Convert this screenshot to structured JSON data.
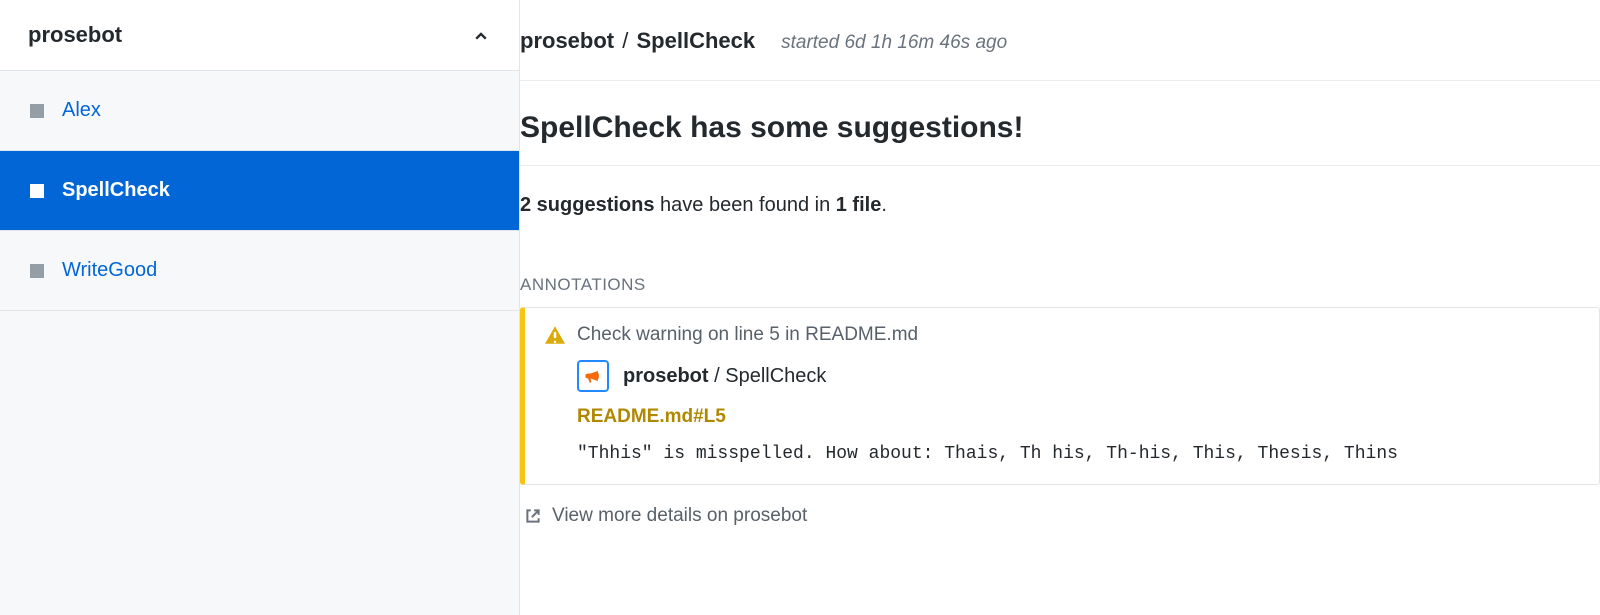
{
  "sidebar": {
    "title": "prosebot",
    "items": [
      {
        "label": "Alex",
        "active": false
      },
      {
        "label": "SpellCheck",
        "active": true
      },
      {
        "label": "WriteGood",
        "active": false
      }
    ]
  },
  "header": {
    "breadcrumb_app": "prosebot",
    "breadcrumb_sep": "/",
    "breadcrumb_check": "SpellCheck",
    "started": "started 6d 1h 16m 46s ago"
  },
  "report": {
    "title": "SpellCheck has some suggestions!",
    "summary_count": "2 suggestions",
    "summary_middle": " have been found in ",
    "summary_files": "1 file",
    "summary_tail": "."
  },
  "annotations": {
    "heading": "ANNOTATIONS",
    "item": {
      "header": "Check warning on line 5 in README.md",
      "app_name": "prosebot",
      "app_sep": " / ",
      "check_name": "SpellCheck",
      "file_link": "README.md#L5",
      "message": "\"Thhis\" is misspelled. How about: Thais, Th his, Th-his, This, Thesis, Thins"
    }
  },
  "footer": {
    "view_more": "View more details on prosebot"
  }
}
